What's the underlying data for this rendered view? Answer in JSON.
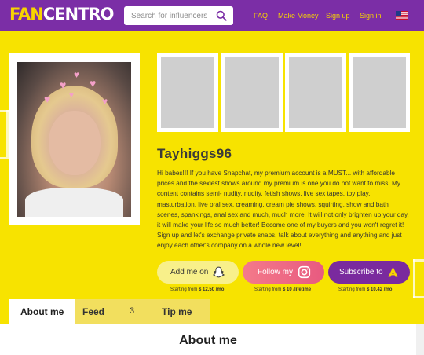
{
  "header": {
    "logo_part1": "FAN",
    "logo_part2": "CENTRO",
    "search_placeholder": "Search for influencers",
    "nav": [
      "FAQ",
      "Make Money",
      "Sign up",
      "Sign in"
    ],
    "language_icon": "us-flag-icon"
  },
  "profile": {
    "username": "Tayhiggs96",
    "bio": "Hi babes!!! If you have Snapchat, my premium account is a MUST... with affordable prices and the sexiest shows around my premium is one you do not want to miss! My content contains semi- nudity, nudity, fetish shows, live sex tapes, toy play, masturbation, live oral sex, creaming, cream pie shows, squirting, show and bath scenes, spankings, anal sex and much, much more. It will not only brighten up your day, it will make your life so much better! Become one of my buyers and you won't regret it! Sign up and let's exchange private snaps, talk about everything and anything and just enjoy each other's company on a whole new level!"
  },
  "actions": [
    {
      "label": "Add me on",
      "icon": "snapchat-icon",
      "price_prefix": "Starting from",
      "price": "$ 12.50 /mo"
    },
    {
      "label": "Follow my",
      "icon": "instagram-icon",
      "price_prefix": "Starting from",
      "price": "$ 10 /lifetime"
    },
    {
      "label": "Subscribe to",
      "icon": "fancentro-icon",
      "price_prefix": "Starting from",
      "price": "$ 10.42 /mo"
    }
  ],
  "tabs": [
    {
      "label": "About me"
    },
    {
      "label": "Feed",
      "count": "3"
    },
    {
      "label": "Tip me"
    }
  ],
  "section_title": "About me",
  "colors": {
    "header": "#7b2ea6",
    "page_bg": "#f7e300",
    "accent_yellow": "#f7d400"
  }
}
